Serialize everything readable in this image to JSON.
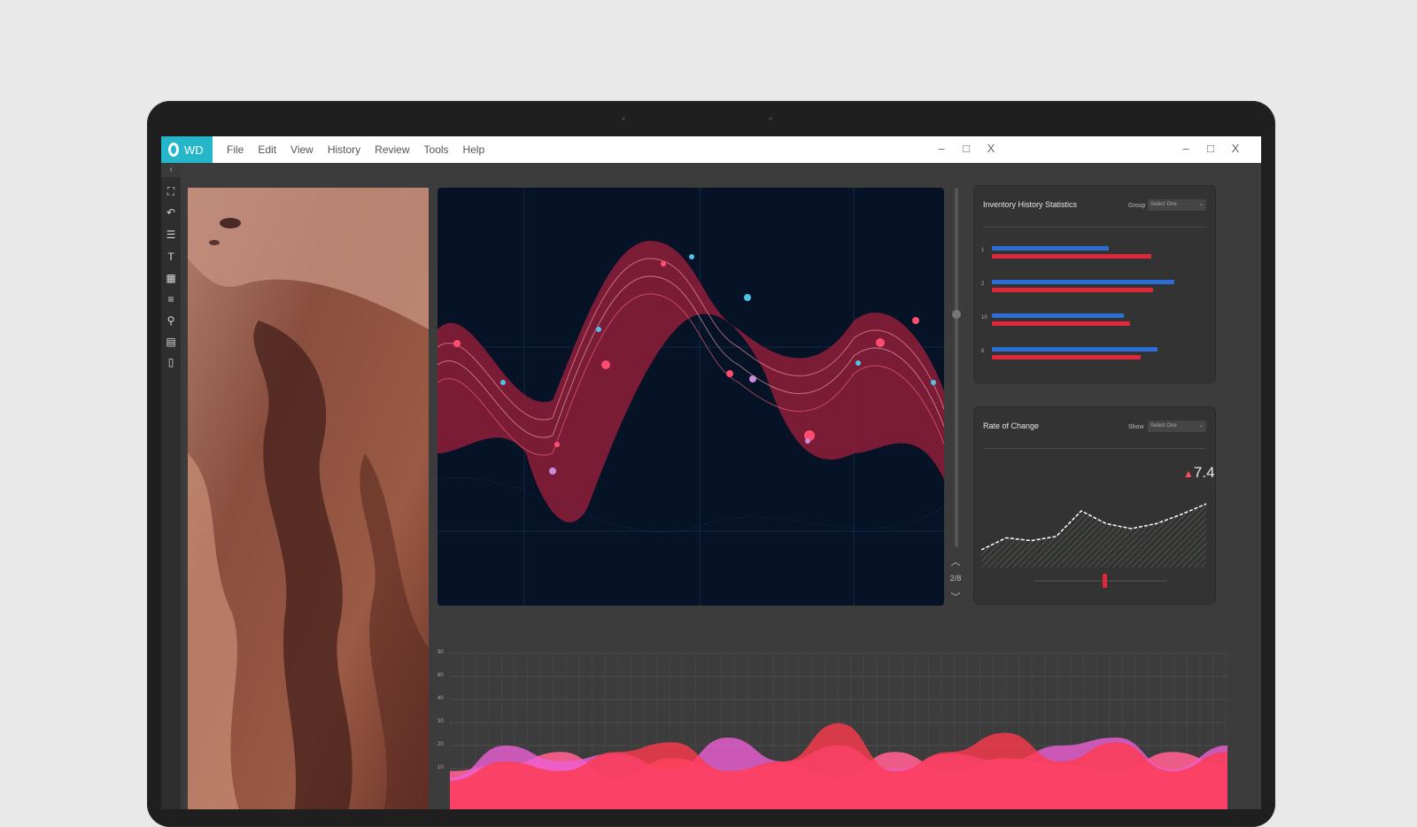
{
  "app": {
    "logo_text": "WD"
  },
  "menu": [
    "File",
    "Edit",
    "View",
    "History",
    "Review",
    "Tools",
    "Help"
  ],
  "window_controls": {
    "minimize": "–",
    "maximize": "□",
    "close": "X"
  },
  "toolbar": {
    "collapse_icon": "chevron-left-icon",
    "tools": [
      "expand-icon",
      "undo-icon",
      "sliders-icon",
      "text-tool-icon",
      "grid-icon",
      "list-icon",
      "link-icon",
      "layers-icon",
      "document-icon"
    ]
  },
  "pager": {
    "page": "2/8"
  },
  "inventory_card": {
    "title": "Inventory History Statistics",
    "filter_label": "Group",
    "filter_value": "Select One",
    "rows": [
      {
        "label": "1",
        "blue": 0.55,
        "red": 0.75
      },
      {
        "label": "2",
        "blue": 0.86,
        "red": 0.76
      },
      {
        "label": "10",
        "blue": 0.62,
        "red": 0.65
      },
      {
        "label": "8",
        "blue": 0.78,
        "red": 0.7
      }
    ],
    "colors": {
      "blue": "#2b6fd6",
      "red": "#e0283a"
    }
  },
  "rate_card": {
    "title": "Rate of Change",
    "filter_label": "Show",
    "filter_value": "Select One",
    "value": "7.4",
    "trend": "up",
    "trend_color": "#ff4d61",
    "line_points": [
      0.25,
      0.42,
      0.38,
      0.44,
      0.8,
      0.62,
      0.55,
      0.62,
      0.75,
      0.9
    ]
  },
  "bottom_chart": {
    "y_ticks": [
      "30",
      "60",
      "40",
      "30",
      "20",
      "10"
    ],
    "colors": [
      "#ff5f8f",
      "#ee5fd6",
      "#ff3a4e"
    ]
  },
  "chart_data": {
    "type": "area",
    "title": "",
    "y_ticks": [
      "30",
      "60",
      "40",
      "30",
      "20",
      "10"
    ],
    "series": [
      {
        "values": [
          0.6,
          0.7,
          0.9,
          0.5,
          0.8,
          0.6,
          0.7,
          0.5,
          0.9,
          0.6,
          0.8,
          0.7,
          0.6,
          0.9,
          0.7
        ]
      },
      {
        "values": [
          0.4,
          0.8,
          0.6,
          0.7,
          0.5,
          0.9,
          0.6,
          0.8,
          0.5,
          0.7,
          0.6,
          0.8,
          0.9,
          0.5,
          0.8
        ]
      },
      {
        "values": [
          0.3,
          0.5,
          0.4,
          0.6,
          0.7,
          0.4,
          0.5,
          0.9,
          0.4,
          0.6,
          0.8,
          0.5,
          0.7,
          0.4,
          0.6
        ]
      }
    ]
  }
}
